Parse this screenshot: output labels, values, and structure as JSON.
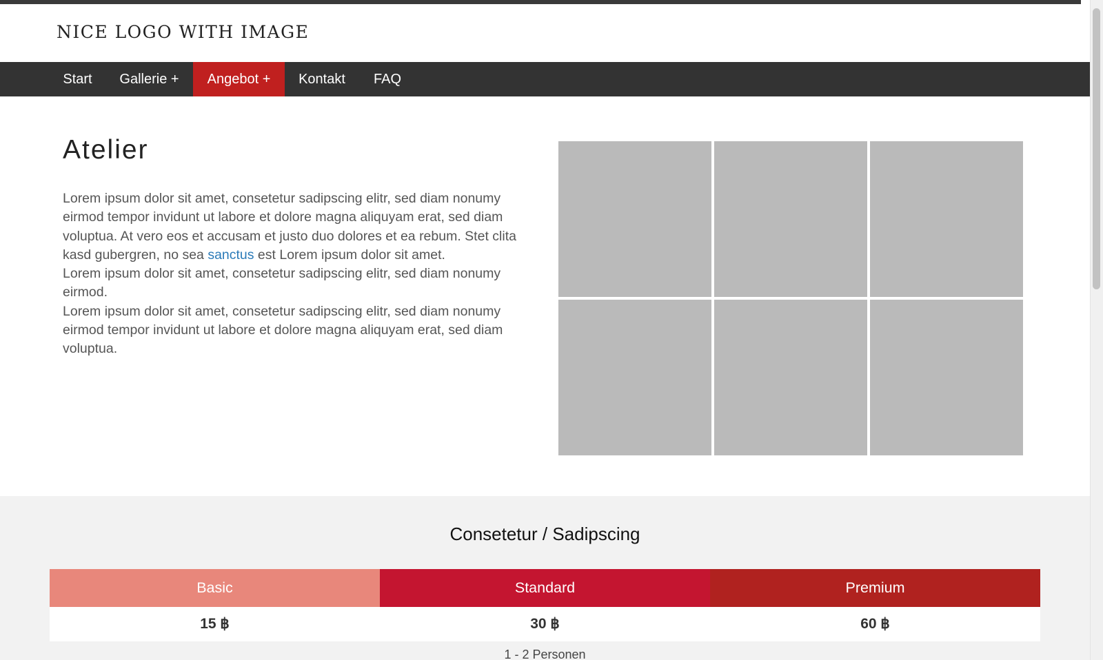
{
  "logo": {
    "text": "NICE LOGO WITH IMAGE"
  },
  "nav": {
    "items": [
      {
        "label": "Start"
      },
      {
        "label": "Gallerie +"
      },
      {
        "label": "Angebot +"
      },
      {
        "label": "Kontakt"
      },
      {
        "label": "FAQ"
      }
    ],
    "active_index": 2
  },
  "main": {
    "heading": "Atelier",
    "p1_before_link": "Lorem ipsum dolor sit amet, consetetur sadipscing elitr, sed diam nonumy eirmod tempor invidunt ut labore et dolore magna aliquyam erat, sed diam voluptua. At vero eos et accusam et justo duo dolores et ea rebum. Stet clita kasd gubergren, no sea ",
    "p1_link": "sanctus",
    "p1_after_link": " est Lorem ipsum dolor sit amet.",
    "p2": "Lorem ipsum dolor sit amet, consetetur sadipscing elitr, sed diam nonumy eirmod.",
    "p3": "Lorem ipsum dolor sit amet, consetetur sadipscing elitr, sed diam nonumy eirmod tempor invidunt ut labore et dolore magna aliquyam erat, sed diam voluptua."
  },
  "gallery": {
    "thumb_count": 6,
    "placeholder_color": "#bababa"
  },
  "pricing": {
    "title": "Consetetur / Sadipscing",
    "plans": [
      {
        "name": "Basic",
        "price": "15 ฿",
        "color": "#e8877b"
      },
      {
        "name": "Standard",
        "price": "30 ฿",
        "color": "#c41530"
      },
      {
        "name": "Premium",
        "price": "60 ฿",
        "color": "#b0221f"
      }
    ],
    "persons": "1 - 2 Personen"
  },
  "colors": {
    "nav_bg": "#333333",
    "accent": "#c0201f",
    "link": "#2a7ab8",
    "section_bg": "#f2f2f2"
  }
}
